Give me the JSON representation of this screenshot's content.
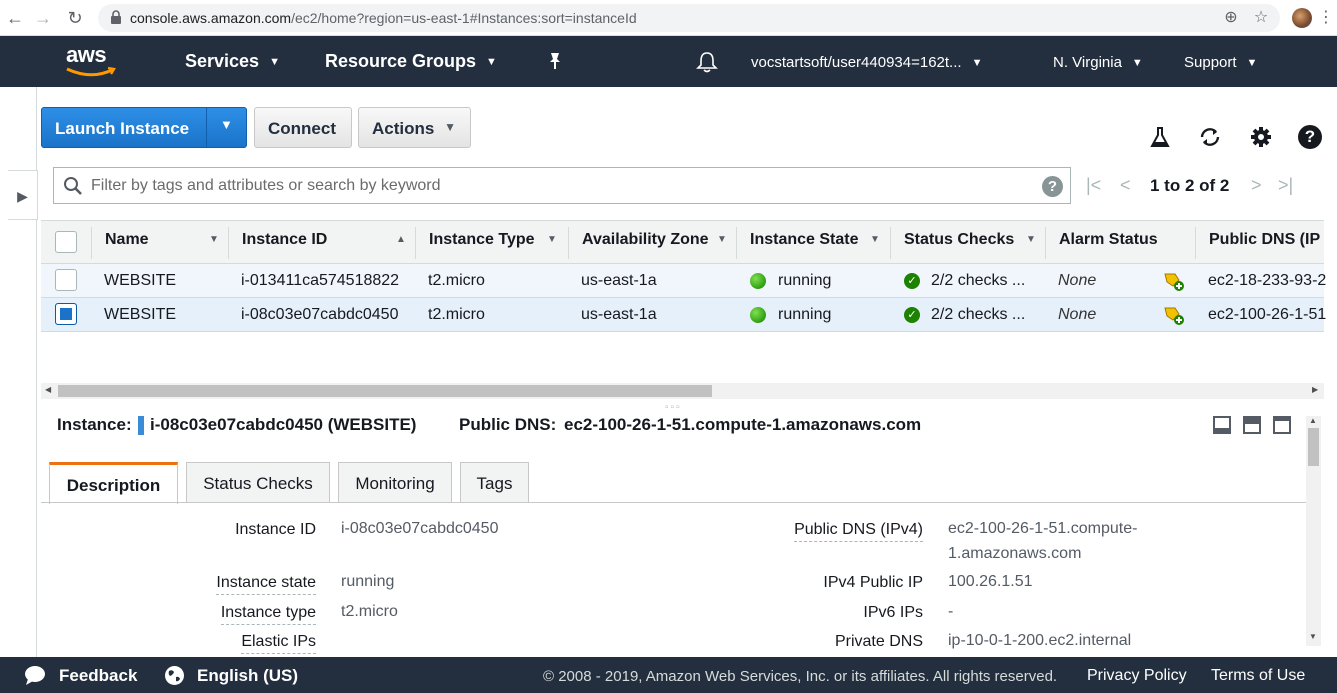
{
  "browser": {
    "url_host": "console.aws.amazon.com",
    "url_path": "/ec2/home?region=us-east-1#Instances:sort=instanceId"
  },
  "nav": {
    "services": "Services",
    "resource_groups": "Resource Groups",
    "account": "vocstartsoft/user440934=162t...",
    "region": "N. Virginia",
    "support": "Support"
  },
  "toolbar": {
    "launch": "Launch Instance",
    "connect": "Connect",
    "actions": "Actions"
  },
  "filter": {
    "placeholder": "Filter by tags and attributes or search by keyword"
  },
  "pager": {
    "text": "1 to 2 of 2"
  },
  "table": {
    "columns": [
      "Name",
      "Instance ID",
      "Instance Type",
      "Availability Zone",
      "Instance State",
      "Status Checks",
      "Alarm Status",
      "Public DNS (IP"
    ],
    "rows": [
      {
        "name": "WEBSITE",
        "id": "i-013411ca574518822",
        "type": "t2.micro",
        "az": "us-east-1a",
        "state": "running",
        "checks": "2/2 checks ...",
        "alarm": "None",
        "dns": "ec2-18-233-93-2",
        "selected": false
      },
      {
        "name": "WEBSITE",
        "id": "i-08c03e07cabdc0450",
        "type": "t2.micro",
        "az": "us-east-1a",
        "state": "running",
        "checks": "2/2 checks ...",
        "alarm": "None",
        "dns": "ec2-100-26-1-51",
        "selected": true
      }
    ]
  },
  "detail": {
    "instance_label": "Instance:",
    "instance_value": "i-08c03e07cabdc0450 (WEBSITE)",
    "dns_label": "Public DNS:",
    "dns_value": "ec2-100-26-1-51.compute-1.amazonaws.com",
    "tabs": [
      "Description",
      "Status Checks",
      "Monitoring",
      "Tags"
    ],
    "left": [
      {
        "label": "Instance ID",
        "value": "i-08c03e07cabdc0450"
      },
      {
        "label": "Instance state",
        "value": "running"
      },
      {
        "label": "Instance type",
        "value": "t2.micro"
      },
      {
        "label": "Elastic IPs",
        "value": ""
      }
    ],
    "right": [
      {
        "label": "Public DNS (IPv4)",
        "value_line1": "ec2-100-26-1-51.compute-",
        "value_line2": "1.amazonaws.com"
      },
      {
        "label": "IPv4 Public IP",
        "value": "100.26.1.51"
      },
      {
        "label": "IPv6 IPs",
        "value": "-"
      },
      {
        "label": "Private DNS",
        "value": "ip-10-0-1-200.ec2.internal"
      }
    ]
  },
  "footer": {
    "feedback": "Feedback",
    "language": "English (US)",
    "copyright": "© 2008 - 2019, Amazon Web Services, Inc. or its affiliates. All rights reserved.",
    "privacy": "Privacy Policy",
    "terms": "Terms of Use"
  }
}
